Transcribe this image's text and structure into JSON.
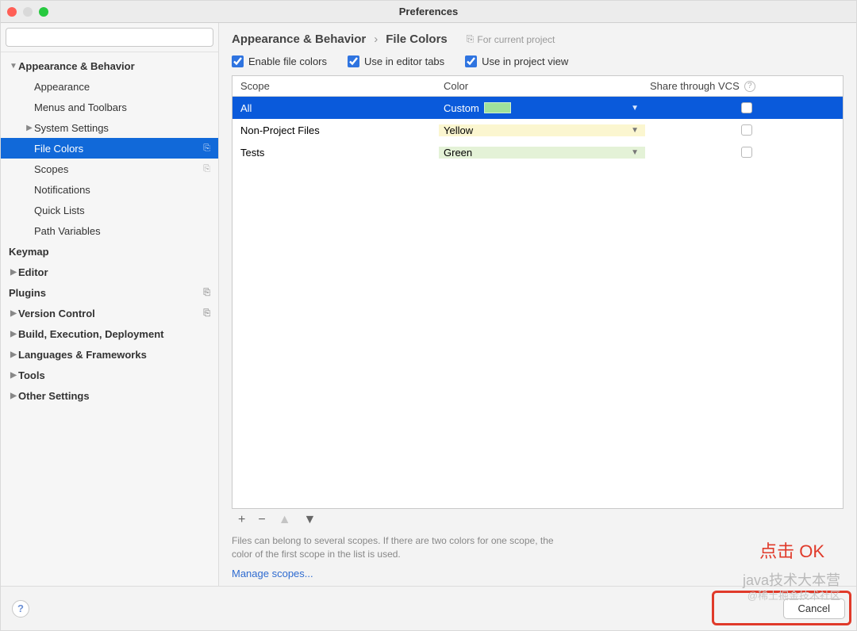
{
  "window": {
    "title": "Preferences"
  },
  "search": {
    "placeholder": ""
  },
  "sidebar": [
    {
      "label": "Appearance & Behavior",
      "depth": 0,
      "arrow": "▼",
      "hasArrow": true
    },
    {
      "label": "Appearance",
      "depth": 1
    },
    {
      "label": "Menus and Toolbars",
      "depth": 1
    },
    {
      "label": "System Settings",
      "depth": 1,
      "arrow": "▶",
      "hasArrow": true
    },
    {
      "label": "File Colors",
      "depth": 1,
      "selected": true,
      "badge": "⎘"
    },
    {
      "label": "Scopes",
      "depth": 1,
      "badge": "⎘"
    },
    {
      "label": "Notifications",
      "depth": 1
    },
    {
      "label": "Quick Lists",
      "depth": 1
    },
    {
      "label": "Path Variables",
      "depth": 1
    },
    {
      "label": "Keymap",
      "depth": 0
    },
    {
      "label": "Editor",
      "depth": 0,
      "arrow": "▶",
      "hasArrow": true
    },
    {
      "label": "Plugins",
      "depth": 0,
      "badge": "⎘"
    },
    {
      "label": "Version Control",
      "depth": 0,
      "arrow": "▶",
      "hasArrow": true,
      "badge": "⎘"
    },
    {
      "label": "Build, Execution, Deployment",
      "depth": 0,
      "arrow": "▶",
      "hasArrow": true
    },
    {
      "label": "Languages & Frameworks",
      "depth": 0,
      "arrow": "▶",
      "hasArrow": true
    },
    {
      "label": "Tools",
      "depth": 0,
      "arrow": "▶",
      "hasArrow": true
    },
    {
      "label": "Other Settings",
      "depth": 0,
      "arrow": "▶",
      "hasArrow": true
    }
  ],
  "breadcrumb": {
    "parent": "Appearance & Behavior",
    "sep": "›",
    "current": "File Colors",
    "hint_icon": "⎘",
    "hint": "For current project"
  },
  "checks": {
    "enable": "Enable file colors",
    "tabs": "Use in editor tabs",
    "project": "Use in project view"
  },
  "table": {
    "headers": {
      "scope": "Scope",
      "color": "Color",
      "share": "Share through VCS"
    },
    "rows": [
      {
        "scope": "All",
        "color": "Custom",
        "swatch": true,
        "selected": true
      },
      {
        "scope": "Non-Project Files",
        "color": "Yellow",
        "rowClass": "yellow"
      },
      {
        "scope": "Tests",
        "color": "Green",
        "rowClass": "green"
      }
    ]
  },
  "toolbar": {
    "add": "+",
    "remove": "−",
    "up": "▲",
    "down": "▼"
  },
  "hintText": "Files can belong to several scopes. If there are two colors for one scope, the color of the first scope in the list is used.",
  "manageLink": "Manage scopes...",
  "footer": {
    "cancel": "Cancel"
  },
  "annotation": "点击 OK",
  "watermark": {
    "line1": "java技术大本营",
    "line2": "@稀土掘金技术社区"
  }
}
